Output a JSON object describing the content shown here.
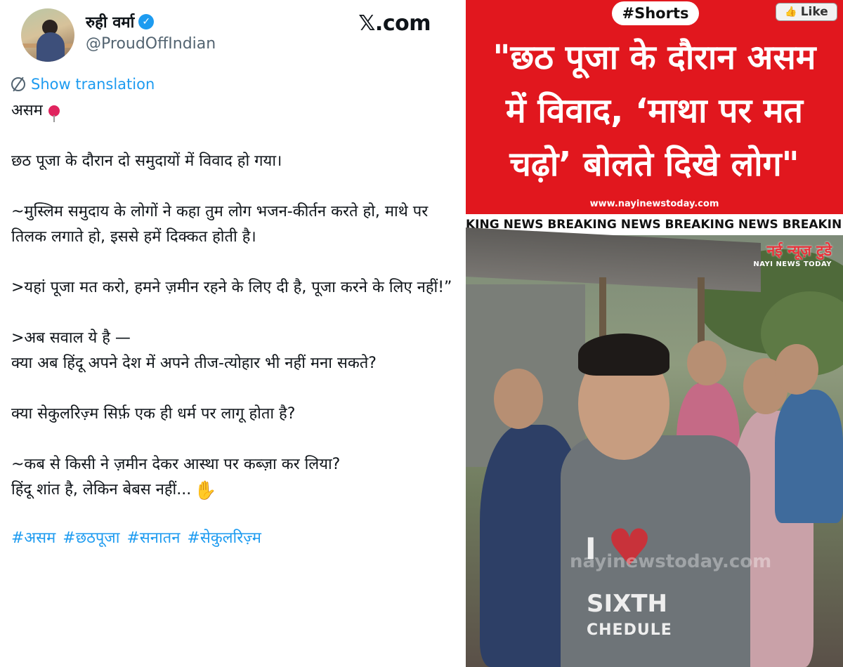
{
  "tweet": {
    "display_name": "रुही वर्मा",
    "verified_icon": "verified-badge-icon",
    "handle": "@ProudOffIndian",
    "platform_label": "𝕏.com",
    "show_translation": "Show translation",
    "paragraphs": [
      "असम",
      "छठ पूजा के दौरान दो समुदायों में विवाद हो गया।",
      "~मुस्लिम समुदाय के लोगों ने कहा तुम लोग भजन-कीर्तन करते हो, माथे पर तिलक लगाते हो, इससे हमें दिक्कत होती है।",
      ">यहां पूजा मत करो, हमने ज़मीन रहने के लिए दी है, पूजा करने के लिए नहीं!”",
      ">अब सवाल ये है —",
      "क्या अब हिंदू अपने देश में अपने तीज-त्योहार भी नहीं मना सकते?",
      "क्या सेकुलरिज़्म सिर्फ़ एक ही धर्म पर लागू होता है?",
      "~कब से किसी ने ज़मीन देकर आस्था पर कब्ज़ा कर लिया?",
      "हिंदू शांत है, लेकिन बेबस नहीं..."
    ],
    "hashtags": [
      "#असम",
      "#छठपूजा",
      "#सनातन",
      "#सेकुलरिज़्म"
    ]
  },
  "video": {
    "shorts_badge": "#Shorts",
    "like_label": "Like",
    "headline_lines": [
      "\"छठ पूजा के दौरान असम",
      "में विवाद, ‘माथा पर मत",
      "चढ़ो’ बोलते दिखे लोग\""
    ],
    "site_url": "www.nayinewstoday.com",
    "ticker": "KING NEWS   BREAKING NEWS   BREAKING NEWS   BREAKIN",
    "channel_logo_hindi": "नई न्यूज़ टुडे",
    "channel_logo_english": "NAYI NEWS TODAY",
    "shirt_letter": "I",
    "shirt_line1": "SIXTH",
    "shirt_line2": "CHEDULE",
    "watermark": "nayinewstoday.com"
  },
  "colors": {
    "accent": "#1d9bf0",
    "headline_bg": "#e1171e",
    "text": "#0f1419",
    "muted": "#536471"
  }
}
